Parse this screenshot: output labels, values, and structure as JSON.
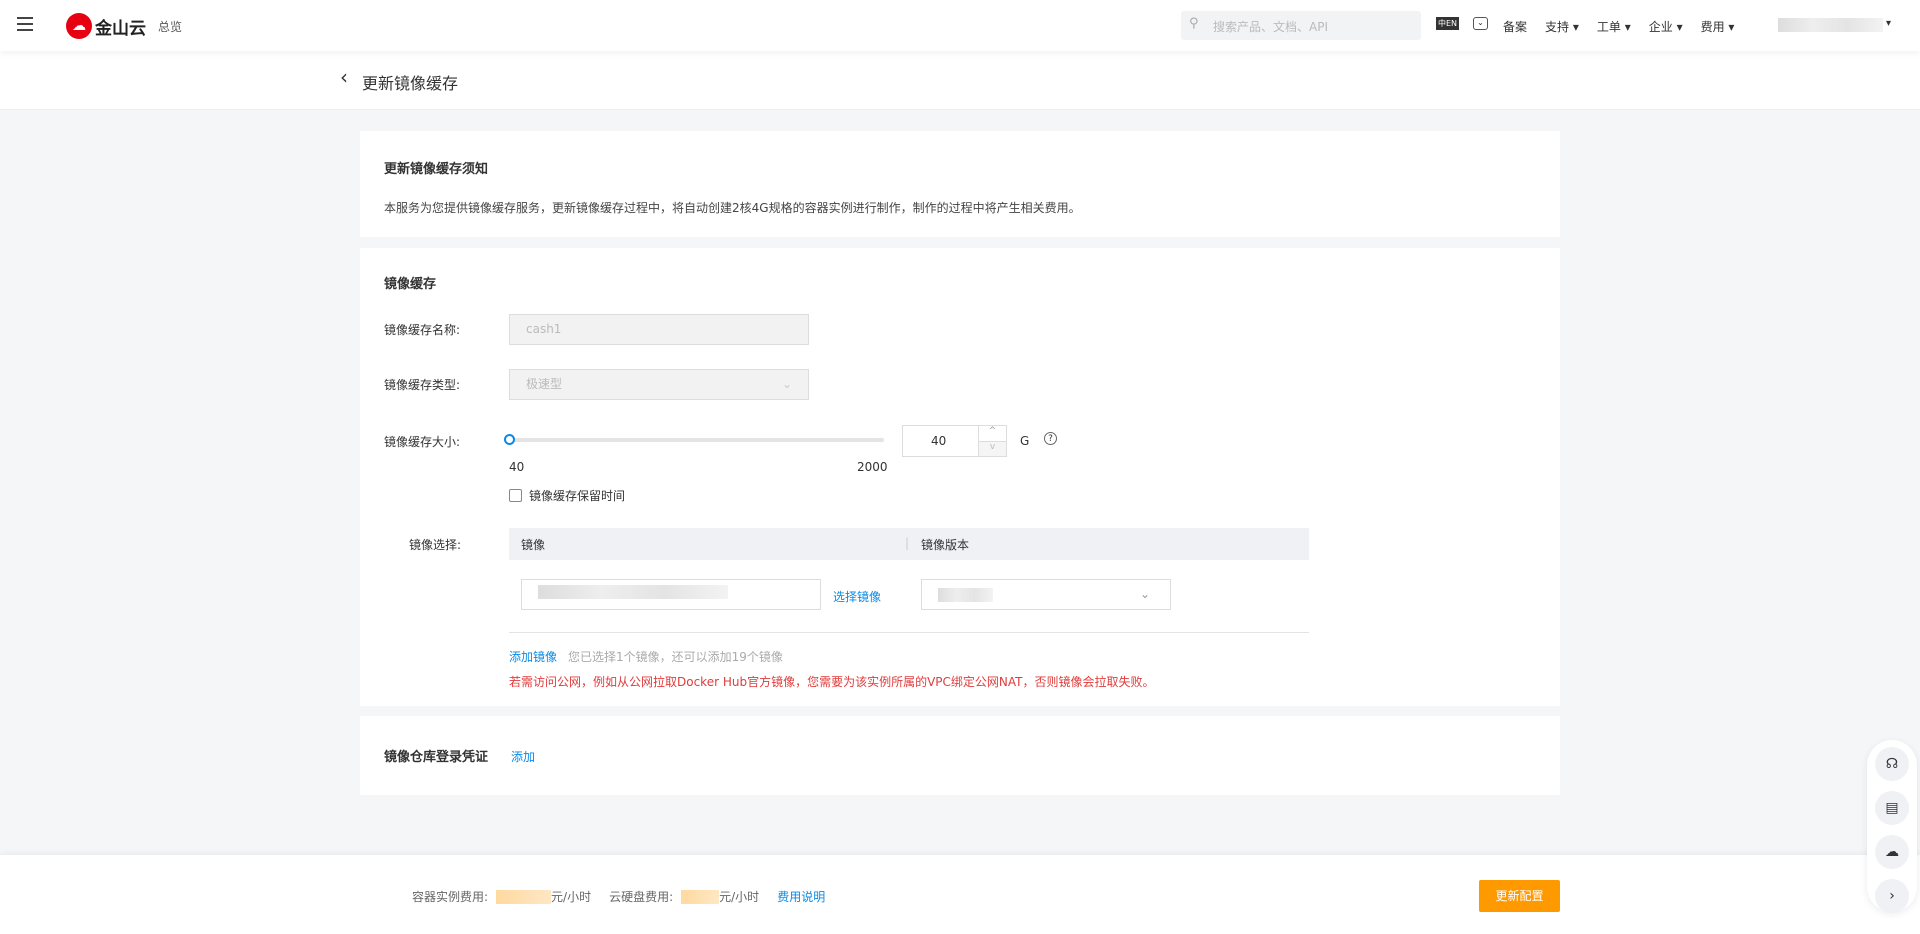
{
  "header": {
    "logo_text": "金山云",
    "overview": "总览",
    "search_placeholder": "搜索产品、文档、API",
    "lang_icon": "中EN",
    "nav": [
      "备案",
      "支持",
      "工单",
      "企业",
      "费用"
    ]
  },
  "page": {
    "title": "更新镜像缓存"
  },
  "notice": {
    "title": "更新镜像缓存须知",
    "text": "本服务为您提供镜像缓存服务，更新镜像缓存过程中，将自动创建2核4G规格的容器实例进行制作，制作的过程中将产生相关费用。"
  },
  "cache": {
    "title": "镜像缓存",
    "name_label": "镜像缓存名称:",
    "name_value": "cash1",
    "type_label": "镜像缓存类型:",
    "type_value": "极速型",
    "size_label": "镜像缓存大小:",
    "size_value": "40",
    "size_min": "40",
    "size_max": "2000",
    "size_unit": "G",
    "slider_fraction": 0,
    "retain_label": "镜像缓存保留时间",
    "retain_checked": false,
    "select_label": "镜像选择:",
    "col_image": "镜像",
    "col_version": "镜像版本",
    "select_image_link": "选择镜像",
    "add_image_link": "添加镜像",
    "add_hint": "您已选择1个镜像，还可以添加19个镜像",
    "warning": "若需访问公网，例如从公网拉取Docker Hub官方镜像，您需要为该实例所属的VPC绑定公网NAT，否则镜像会拉取失败。"
  },
  "registry": {
    "title": "镜像仓库登录凭证",
    "add_link": "添加"
  },
  "footer": {
    "instance_fee_label": "容器实例费用:",
    "disk_fee_label": "云硬盘费用:",
    "unit": "元/小时",
    "fee_link": "费用说明",
    "submit": "更新配置"
  },
  "colors": {
    "accent": "#0a8ae6",
    "primary_button": "#ff9900",
    "warning": "#e03c3c",
    "brand": "#e60012"
  }
}
